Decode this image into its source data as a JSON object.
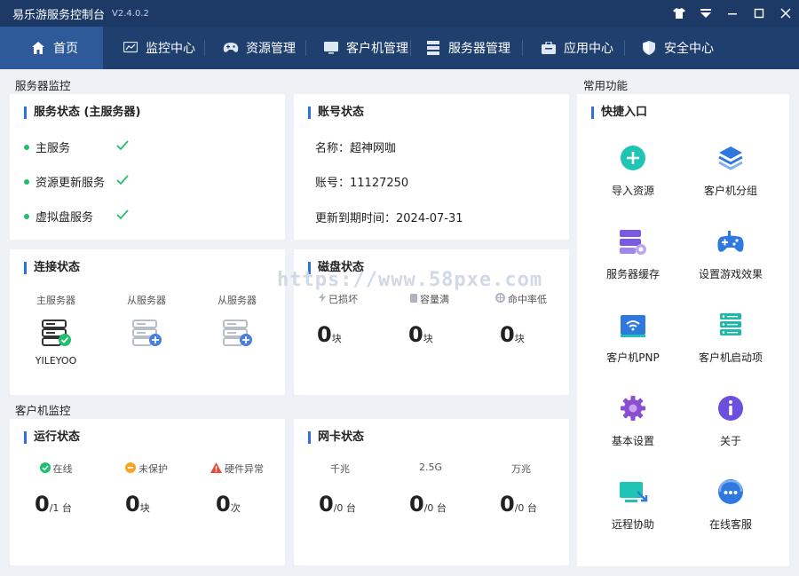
{
  "window": {
    "title": "易乐游服务控制台",
    "version": "V2.4.0.2",
    "controls": [
      "skin-icon",
      "menu-icon",
      "minimize-icon",
      "maximize-icon",
      "close-icon"
    ]
  },
  "nav": {
    "items": [
      {
        "label": "首页",
        "icon": "home-icon",
        "active": true
      },
      {
        "label": "监控中心",
        "icon": "monitor-chart-icon"
      },
      {
        "label": "资源管理",
        "icon": "gamepad-icon"
      },
      {
        "label": "客户机管理",
        "icon": "desktop-icon"
      },
      {
        "label": "服务器管理",
        "icon": "server-icon"
      },
      {
        "label": "应用中心",
        "icon": "app-box-icon"
      },
      {
        "label": "安全中心",
        "icon": "shield-icon"
      }
    ]
  },
  "sections": {
    "server_monitor": "服务器监控",
    "client_monitor": "客户机监控",
    "common_functions": "常用功能"
  },
  "service_status": {
    "title": "服务状态 (主服务器)",
    "items": [
      {
        "label": "主服务",
        "ok": true
      },
      {
        "label": "资源更新服务",
        "ok": true
      },
      {
        "label": "虚拟盘服务",
        "ok": true
      }
    ]
  },
  "account_status": {
    "title": "账号状态",
    "name_line": "名称：超神网咖",
    "account_line": "账号：11127250",
    "expire_line": "更新到期时间：2024-07-31"
  },
  "connection_status": {
    "title": "连接状态",
    "servers": [
      {
        "label": "主服务器",
        "name": "YILEYOO",
        "connected": true
      },
      {
        "label": "从服务器",
        "name": "",
        "connected": false
      },
      {
        "label": "从服务器",
        "name": "",
        "connected": false
      }
    ]
  },
  "disk_status": {
    "title": "磁盘状态",
    "items": [
      {
        "label": "已损坏",
        "value": "0",
        "unit": "块",
        "icon": "bolt-icon"
      },
      {
        "label": "容量满",
        "value": "0",
        "unit": "块",
        "icon": "doc-icon"
      },
      {
        "label": "命中率低",
        "value": "0",
        "unit": "块",
        "icon": "target-icon"
      }
    ]
  },
  "run_status": {
    "title": "运行状态",
    "items": [
      {
        "label": "在线",
        "value": "0",
        "unit": "/1 台",
        "icon": "online-check-icon",
        "color": "#1fbf6b"
      },
      {
        "label": "未保护",
        "value": "0",
        "unit": "块",
        "icon": "minus-circle-icon",
        "color": "#f5a623"
      },
      {
        "label": "硬件异常",
        "value": "0",
        "unit": "次",
        "icon": "warning-icon",
        "color": "#e84a3a"
      }
    ]
  },
  "nic_status": {
    "title": "网卡状态",
    "items": [
      {
        "label": "千兆",
        "value": "0",
        "unit": "/0 台"
      },
      {
        "label": "2.5G",
        "value": "0",
        "unit": "/0 台"
      },
      {
        "label": "万兆",
        "value": "0",
        "unit": "/0 台"
      }
    ]
  },
  "quick_access": {
    "title": "快捷入口",
    "items": [
      {
        "label": "导入资源",
        "icon": "import-plus-icon"
      },
      {
        "label": "客户机分组",
        "icon": "layers-icon"
      },
      {
        "label": "服务器缓存",
        "icon": "server-cache-icon"
      },
      {
        "label": "设置游戏效果",
        "icon": "gamepad-icon"
      },
      {
        "label": "客户机PNP",
        "icon": "wifi-card-icon"
      },
      {
        "label": "客户机启动项",
        "icon": "startup-icon"
      },
      {
        "label": "基本设置",
        "icon": "gear-icon"
      },
      {
        "label": "关于",
        "icon": "info-icon"
      },
      {
        "label": "远程协助",
        "icon": "remote-screen-icon"
      },
      {
        "label": "在线客服",
        "icon": "chat-bubble-icon"
      }
    ]
  },
  "watermark": "https://www.58pxe.com",
  "colors": {
    "titlebar": "#1d3a66",
    "navbar": "#1f3f6e",
    "nav_active": "#2f5a9a",
    "accent": "#2f6fde",
    "ok_green": "#1fbf6b"
  }
}
